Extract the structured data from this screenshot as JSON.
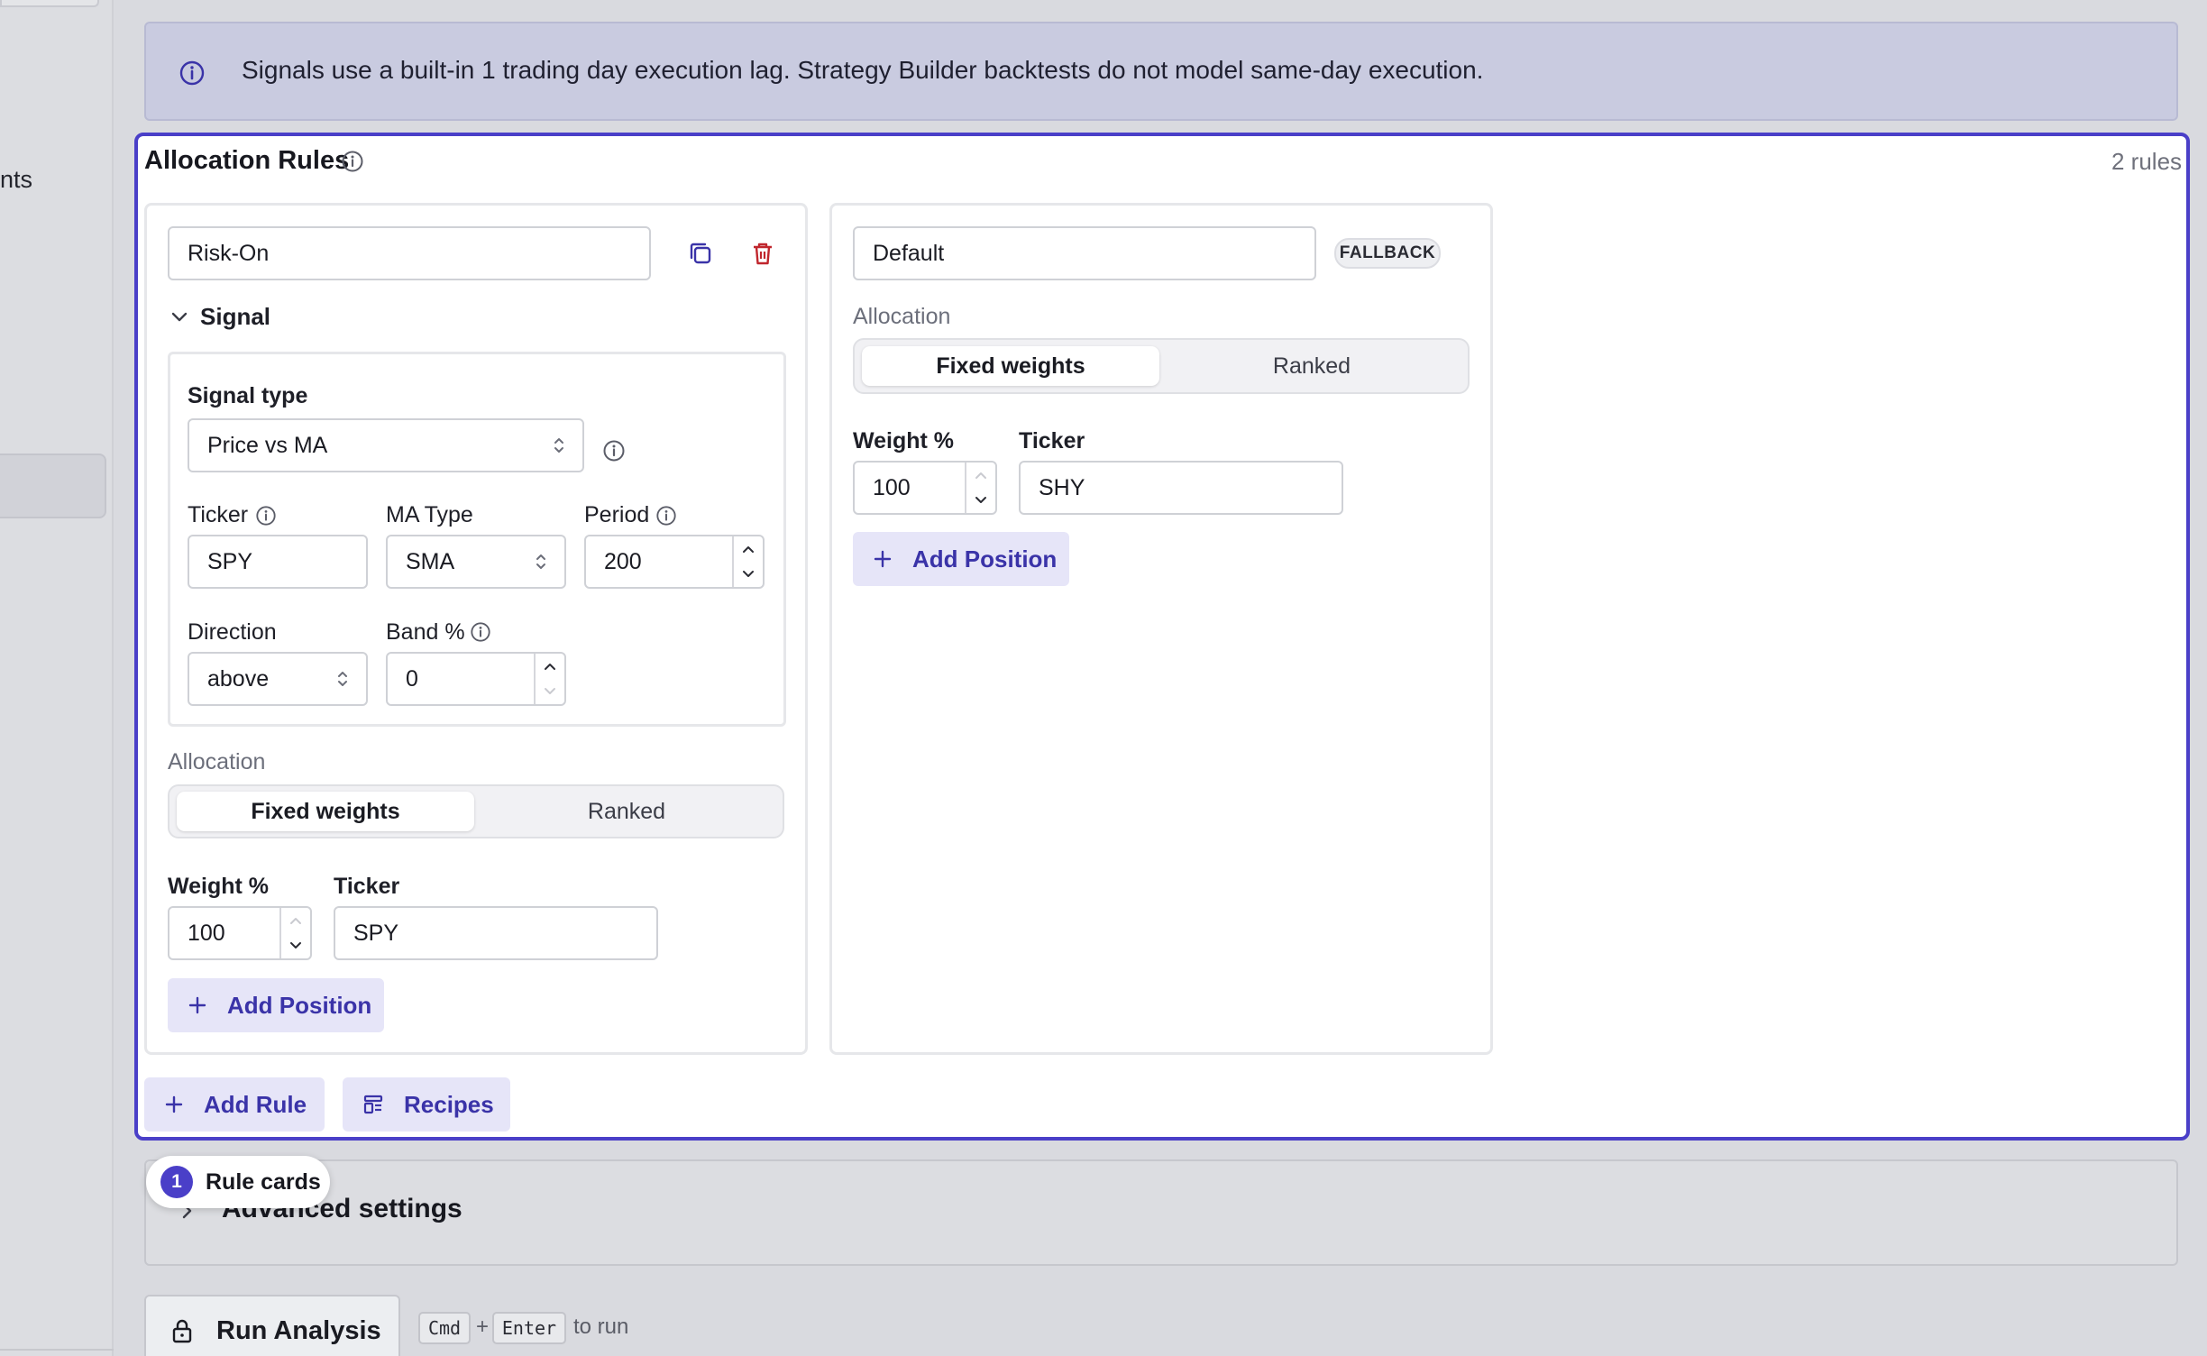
{
  "sidebar": {
    "nav_fragment": "nts"
  },
  "banner": {
    "icon": "info-icon",
    "text": "Signals use a built-in 1 trading day execution lag. Strategy Builder backtests do not model same-day execution."
  },
  "allocation_rules": {
    "title": "Allocation Rules",
    "count": "2 rules",
    "rules": [
      {
        "name": "Risk-On",
        "signal_header": "Signal",
        "signal": {
          "type_label": "Signal type",
          "type_value": "Price vs MA",
          "ticker_label": "Ticker",
          "ticker_value": "SPY",
          "ma_type_label": "MA Type",
          "ma_type_value": "SMA",
          "period_label": "Period",
          "period_value": "200",
          "direction_label": "Direction",
          "direction_value": "above",
          "band_label": "Band %",
          "band_value": "0"
        },
        "allocation_label": "Allocation",
        "modes": [
          "Fixed weights",
          "Ranked"
        ],
        "active_mode": "Fixed weights",
        "weight_label": "Weight %",
        "ticker_label": "Ticker",
        "positions": [
          {
            "weight": "100",
            "ticker": "SPY"
          }
        ],
        "add_position_label": "Add Position"
      },
      {
        "name": "Default",
        "badge": "FALLBACK",
        "allocation_label": "Allocation",
        "modes": [
          "Fixed weights",
          "Ranked"
        ],
        "active_mode": "Fixed weights",
        "weight_label": "Weight %",
        "ticker_label": "Ticker",
        "positions": [
          {
            "weight": "100",
            "ticker": "SHY"
          }
        ],
        "add_position_label": "Add Position"
      }
    ],
    "add_rule_label": "Add Rule",
    "recipes_label": "Recipes"
  },
  "advanced": {
    "label": "Advanced settings"
  },
  "tour": {
    "step": "1",
    "label": "Rule cards"
  },
  "run": {
    "label": "Run Analysis",
    "key1": "Cmd",
    "plus": "+",
    "key2": "Enter",
    "suffix": "to run"
  },
  "colors": {
    "accent": "#4a3fc8",
    "banner_bg": "#c9cbe0",
    "danger": "#c0262d"
  }
}
